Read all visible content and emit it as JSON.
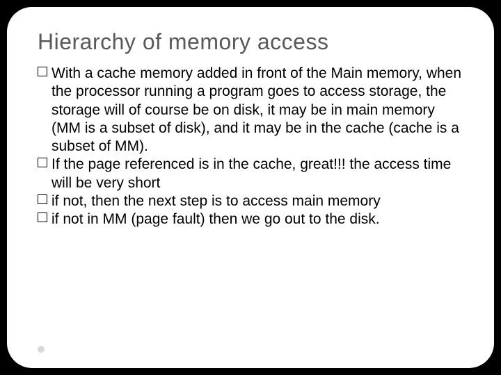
{
  "slide": {
    "title": "Hierarchy of memory access",
    "bullets": [
      {
        "text": "With a cache memory added in front of the Main memory, when the processor running a program goes to access storage, the storage will of course be on disk, it may be in main memory (MM is a subset of disk), and it may be in the cache (cache is a subset of MM)."
      },
      {
        "text": "If the page referenced is in the cache, great!!! the access time will be very short"
      },
      {
        "text": "if not, then the next step is to access main memory"
      },
      {
        "text": "if not in MM (page fault) then we go out to the disk."
      }
    ]
  }
}
